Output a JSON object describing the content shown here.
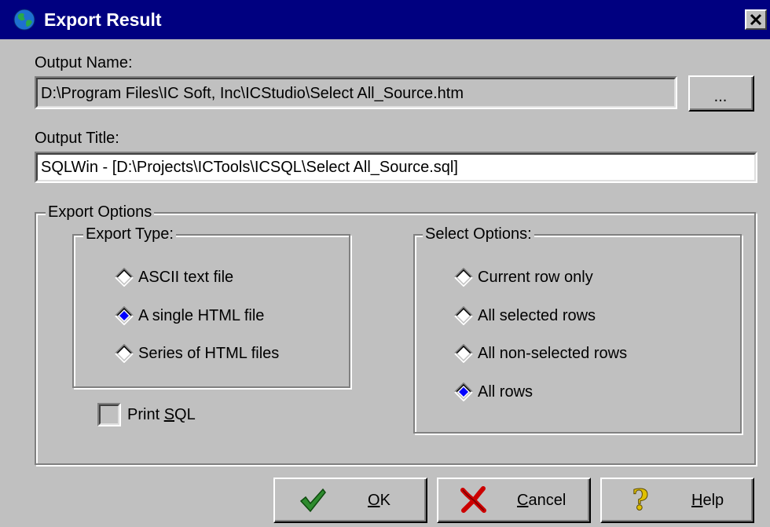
{
  "window": {
    "title": "Export Result"
  },
  "output_name": {
    "label": "Output Name:",
    "value": "D:\\Program Files\\IC Soft, Inc\\ICStudio\\Select All_Source.htm",
    "browse_label": "..."
  },
  "output_title": {
    "label": "Output Title:",
    "value": "SQLWin  -  [D:\\Projects\\ICTools\\ICSQL\\Select All_Source.sql]"
  },
  "export_options": {
    "legend": "Export Options",
    "export_type": {
      "legend": "Export Type:",
      "options": [
        {
          "label": "ASCII text file",
          "selected": false
        },
        {
          "label": "A single HTML file",
          "selected": true
        },
        {
          "label": "Series of HTML files",
          "selected": false
        }
      ]
    },
    "select_options": {
      "legend": "Select Options:",
      "options": [
        {
          "label": "Current row only",
          "selected": false
        },
        {
          "label": "All selected rows",
          "selected": false
        },
        {
          "label": "All non-selected rows",
          "selected": false
        },
        {
          "label": "All rows",
          "selected": true
        }
      ]
    },
    "print_sql": {
      "label_prefix": "Print ",
      "label_mnemonic": "S",
      "label_suffix": "QL",
      "checked": false
    }
  },
  "buttons": {
    "ok": {
      "mnemonic": "O",
      "rest": "K",
      "icon": "checkmark-icon"
    },
    "cancel": {
      "mnemonic": "C",
      "rest": "ancel",
      "icon": "red-x-icon"
    },
    "help": {
      "mnemonic": "H",
      "rest": "elp",
      "icon": "question-icon"
    }
  },
  "colors": {
    "titlebar": "#000080",
    "face": "#c0c0c0",
    "radio_selected": "#0000ff",
    "ok_icon": "#2e8b2e",
    "cancel_icon": "#cc0000",
    "help_icon": "#e0c000"
  }
}
